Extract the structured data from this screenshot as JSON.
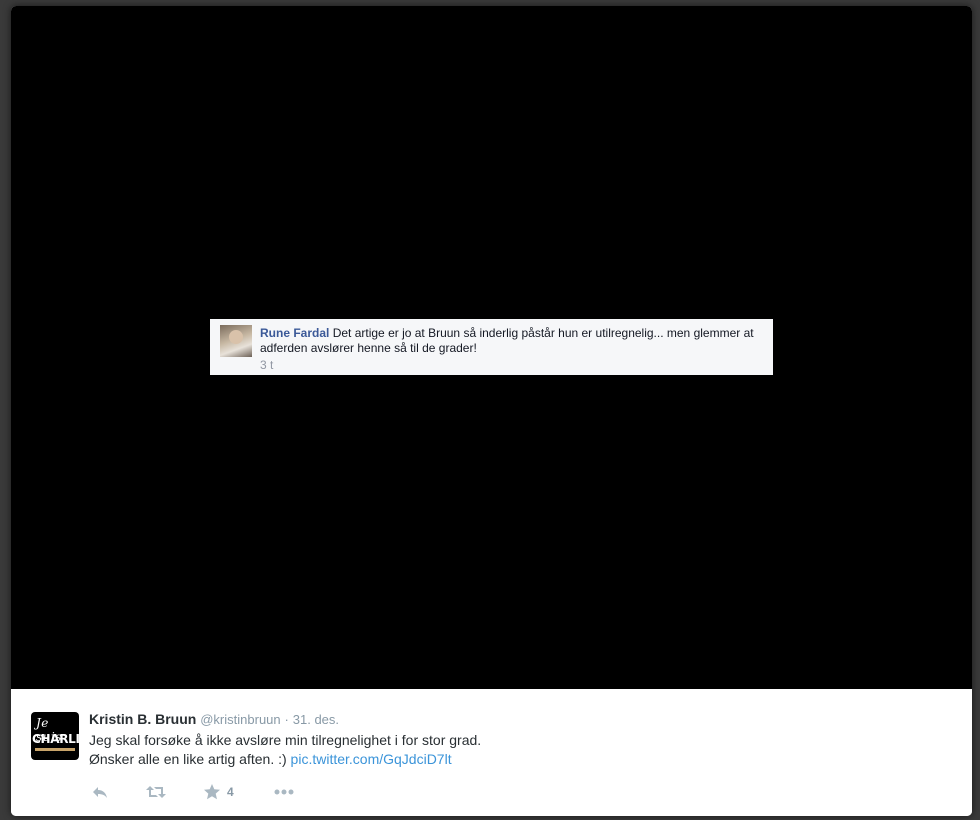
{
  "comment": {
    "author": "Rune Fardal",
    "text": "Det artige er jo at Bruun så inderlig påstår hun er utilregnelig... men glemmer at adferden avslører henne så til de grader!",
    "time": "3 t"
  },
  "tweet": {
    "avatar_line1": "Je suis",
    "avatar_line2": "CHARLIE",
    "name": "Kristin B. Bruun",
    "handle": "@kristinbruun",
    "separator": "·",
    "date": "31. des.",
    "text_line1": "Jeg skal forsøke å ikke avsløre min tilregnelighet i for stor grad.",
    "text_line2": "Ønsker alle en like artig aften. :)",
    "link": "pic.twitter.com/GqJdciD7lt",
    "favorites": "4"
  },
  "icons": [
    "reply-icon",
    "retweet-icon",
    "favorite-icon",
    "more-icon"
  ],
  "colors": {
    "link": "#3b94d9",
    "fb_name": "#3b5998",
    "muted": "#8899a6",
    "media_bg": "#000000"
  }
}
